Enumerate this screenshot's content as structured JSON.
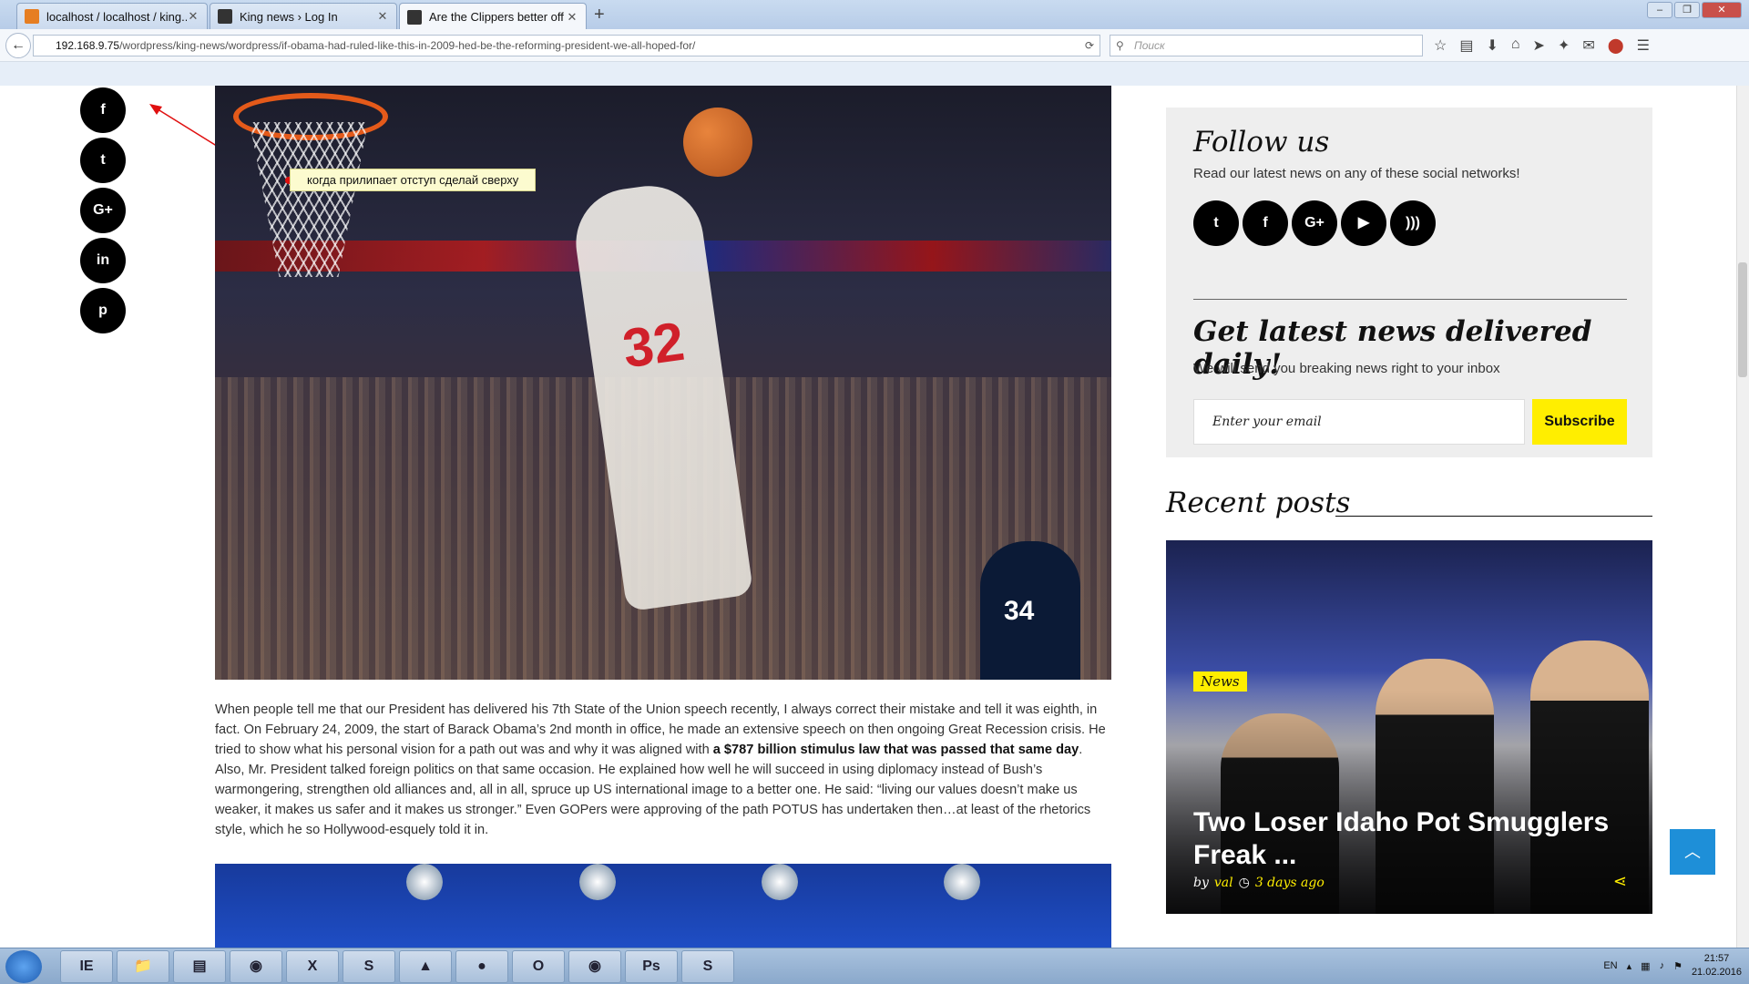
{
  "browser": {
    "tabs": [
      {
        "title": "localhost / localhost / king...",
        "favicon_color": "#e67e22"
      },
      {
        "title": "King news › Log In",
        "favicon_color": "#333333"
      },
      {
        "title": "Are the Clippers better off ...",
        "favicon_color": "#333333",
        "active": true
      }
    ],
    "url_host": "192.168.9.75",
    "url_path": "/wordpress/king-news/wordpress/if-obama-had-ruled-like-this-in-2009-hed-be-the-reforming-president-we-all-hoped-for/",
    "search_placeholder": "Поиск"
  },
  "share_bar": {
    "buttons": [
      {
        "name": "facebook",
        "glyph": "f"
      },
      {
        "name": "twitter",
        "glyph": "t"
      },
      {
        "name": "google-plus",
        "glyph": "G+"
      },
      {
        "name": "linkedin",
        "glyph": "in"
      },
      {
        "name": "pinterest",
        "glyph": "p"
      }
    ]
  },
  "hero": {
    "annotation_note": "когда прилипает отступ сделай сверху",
    "jersey_number": "32",
    "opponent_number": "34"
  },
  "article": {
    "p1_a": "When people tell me that our President has delivered his 7th State of the Union speech recently, I always correct their mistake and tell it was eighth, in fact. On February 24, 2009, the start of Barack Obama’s 2nd month in office, he made an extensive speech on then ongoing Great Recession crisis. He tried to show what his personal vision for a path out was and why it was aligned with ",
    "p1_bold": "a $787 billion stimulus law that was passed that same day",
    "p1_b": ". Also, Mr. President talked foreign politics on that same occasion. He explained how well he will succeed in using diplomacy instead of Bush’s warmongering, strengthen old alliances and, all in all, spruce up US international image to a better one. He said: “living our values doesn’t make us weaker, it makes us safer and it makes us stronger.” Even GOPers were approving of the path POTUS has undertaken then…at least of the rhetorics style, which he so Hollywood-esquely told it in."
  },
  "sidebar": {
    "follow": {
      "title": "Follow us",
      "description": "Read our latest news on any of these social networks!",
      "networks": [
        {
          "name": "twitter",
          "glyph": "t"
        },
        {
          "name": "facebook",
          "glyph": "f"
        },
        {
          "name": "google-plus",
          "glyph": "G+"
        },
        {
          "name": "youtube",
          "glyph": "▶"
        },
        {
          "name": "rss",
          "glyph": ")))"
        }
      ]
    },
    "newsletter": {
      "title": "Get latest news delivered daily!",
      "description": "We will send you breaking news right to your inbox",
      "email_placeholder": "Enter your email",
      "button_label": "Subscribe"
    },
    "recent": {
      "title": "Recent posts",
      "post": {
        "category": "News",
        "title": "Two Loser Idaho Pot Smugglers Freak ...",
        "by": "by",
        "author": "val",
        "date": "3 days ago"
      }
    }
  },
  "taskbar": {
    "apps": [
      "IE",
      "📁",
      "▤",
      "◉",
      "X",
      "S",
      "▲",
      "●",
      "O",
      "◉",
      "Ps",
      "S"
    ],
    "lang": "EN",
    "time": "21:57",
    "date": "21.02.2016"
  },
  "colors": {
    "accent_yellow": "#ffee00",
    "back_to_top": "#1e8fd8",
    "social_black": "#000000"
  }
}
